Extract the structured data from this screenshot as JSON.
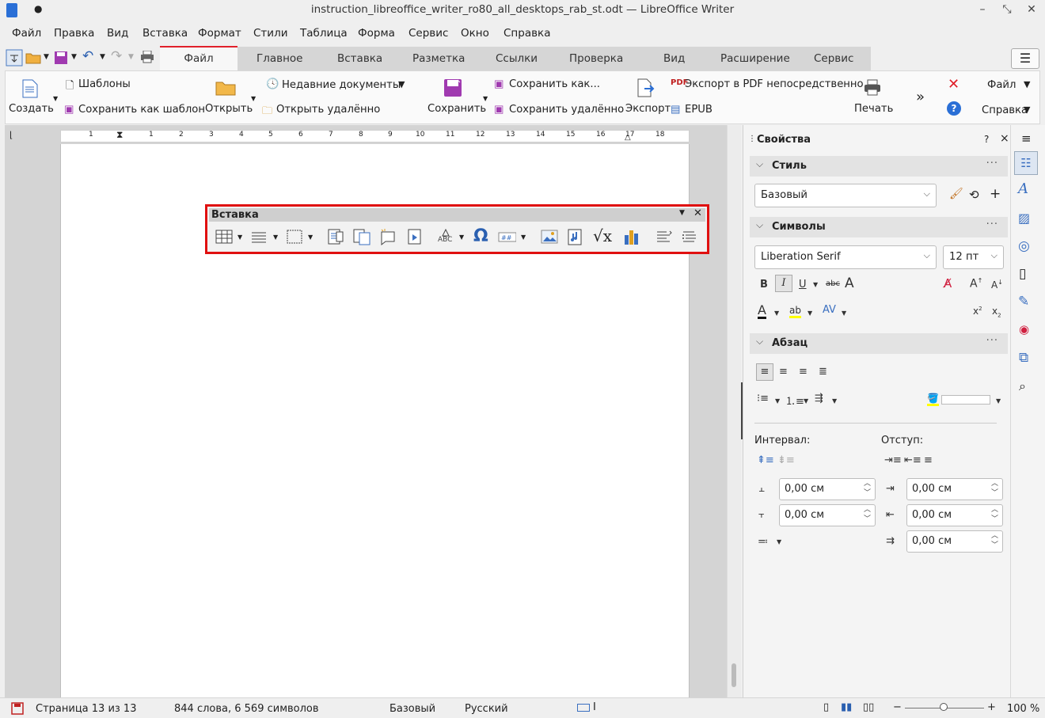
{
  "window": {
    "title": "instruction_libreoffice_writer_ro80_all_desktops_rab_st.odt — LibreOffice Writer",
    "modified_dot": "●"
  },
  "menu": [
    "Файл",
    "Правка",
    "Вид",
    "Вставка",
    "Формат",
    "Стили",
    "Таблица",
    "Форма",
    "Сервис",
    "Окно",
    "Справка"
  ],
  "tabs": [
    "Файл",
    "Главное",
    "Вставка",
    "Разметка",
    "Ссылки",
    "Проверка",
    "Вид",
    "Расширение",
    "Сервис"
  ],
  "active_tab": "Файл",
  "ribbon": {
    "create": "Создать",
    "templates": "Шаблоны",
    "save_as_template": "Сохранить как шаблон",
    "open": "Открыть",
    "recent_docs": "Недавние документы",
    "open_remote": "Открыть удалённо",
    "save": "Сохранить",
    "save_as": "Сохранить как...",
    "save_remote": "Сохранить удалённо",
    "export": "Экспорт",
    "export_pdf": "Экспорт в PDF непосредственно",
    "epub": "EPUB",
    "print": "Печать",
    "file_menu": "Файл",
    "help_menu": "Справка"
  },
  "ruler_numbers": [
    "1",
    "1",
    "2",
    "3",
    "4",
    "5",
    "6",
    "7",
    "8",
    "9",
    "10",
    "11",
    "12",
    "13",
    "14",
    "15",
    "16",
    "17",
    "18"
  ],
  "floating_toolbar": {
    "title": "Вставка"
  },
  "sidebar": {
    "title": "Свойства",
    "help": "?",
    "close": "×",
    "style_section": "Стиль",
    "style_value": "Базовый",
    "chars_section": "Символы",
    "font_name": "Liberation Serif",
    "font_size": "12 пт",
    "bold": "B",
    "italic": "I",
    "underline": "U",
    "strike": "abc",
    "para_section": "Абзац",
    "spacing_label": "Интервал:",
    "indent_label": "Отступ:",
    "above_spacing": "0,00 см",
    "below_spacing": "0,00 см",
    "indent_before": "0,00 см",
    "indent_after": "0,00 см",
    "first_line": "0,00 см"
  },
  "status": {
    "page": "Страница 13 из 13",
    "words": "844 слова, 6 569 символов",
    "page_style": "Базовый",
    "language": "Русский",
    "zoom": "100 %"
  },
  "colors": {
    "accent_red": "#e0202a",
    "highlight_yellow": "#ffff00",
    "toolbar_frame": "#e01010"
  }
}
